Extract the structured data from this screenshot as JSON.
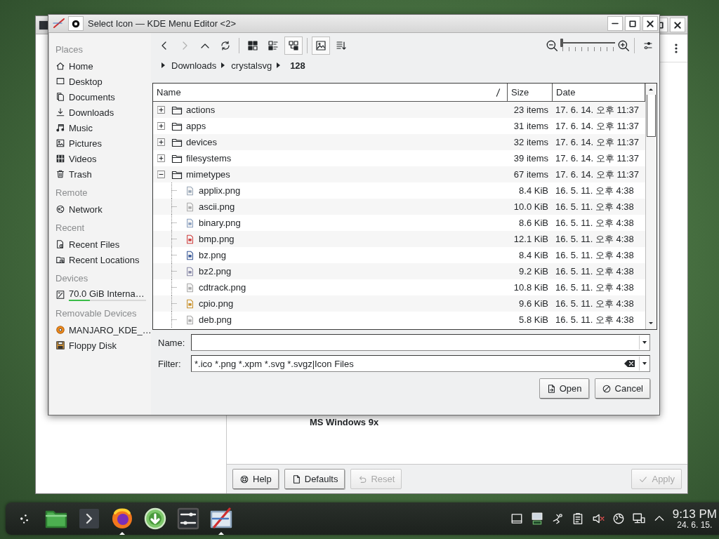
{
  "background_window": {
    "caption": "MS Windows 9x",
    "buttons": [
      {
        "label": "Help",
        "disabled": false
      },
      {
        "label": "Defaults",
        "disabled": false
      },
      {
        "label": "Reset",
        "disabled": true
      },
      {
        "label": "Apply",
        "disabled": true
      }
    ]
  },
  "dialog": {
    "title": "Select Icon — KDE Menu Editor <2>",
    "view_modes": [
      {
        "selected": false
      },
      {
        "selected": false
      },
      {
        "selected": true
      }
    ],
    "preview": {
      "on": true
    },
    "zoom": {
      "level": 0
    },
    "breadcrumb": [
      {
        "label": "Downloads",
        "current": false
      },
      {
        "label": "crystalsvg",
        "current": false
      },
      {
        "label": "128",
        "current": true
      }
    ],
    "places": [
      {
        "heading": "Places",
        "items": [
          {
            "label": "Home"
          },
          {
            "label": "Desktop"
          },
          {
            "label": "Documents"
          },
          {
            "label": "Downloads"
          },
          {
            "label": "Music"
          },
          {
            "label": "Pictures"
          },
          {
            "label": "Videos"
          },
          {
            "label": "Trash"
          }
        ]
      },
      {
        "heading": "Remote",
        "items": [
          {
            "label": "Network"
          }
        ]
      },
      {
        "heading": "Recent",
        "items": [
          {
            "label": "Recent Files"
          },
          {
            "label": "Recent Locations"
          }
        ]
      },
      {
        "heading": "Devices",
        "items": [
          {
            "label": "70.0 GiB Interna…",
            "level": 0.27
          }
        ]
      },
      {
        "heading": "Removable Devices",
        "items": [
          {
            "label": "MANJARO_KDE_…"
          },
          {
            "label": "Floppy Disk"
          }
        ]
      }
    ],
    "columns": [
      "Name",
      "Size",
      "Date"
    ],
    "rows": [
      {
        "name": "actions",
        "kind": "folder",
        "expanded": false,
        "size": "23 items",
        "date": "17. 6. 14. 오후 11:37"
      },
      {
        "name": "apps",
        "kind": "folder",
        "expanded": false,
        "size": "31 items",
        "date": "17. 6. 14. 오후 11:37"
      },
      {
        "name": "devices",
        "kind": "folder",
        "expanded": false,
        "size": "32 items",
        "date": "17. 6. 14. 오후 11:37"
      },
      {
        "name": "filesystems",
        "kind": "folder",
        "expanded": false,
        "size": "39 items",
        "date": "17. 6. 14. 오후 11:37"
      },
      {
        "name": "mimetypes",
        "kind": "folder",
        "expanded": true,
        "size": "67 items",
        "date": "17. 6. 14. 오후 11:37",
        "children": [
          {
            "name": "applix.png",
            "kind": "file",
            "size": "8.4 KiB",
            "date": "16. 5. 11. 오후 4:38"
          },
          {
            "name": "ascii.png",
            "kind": "file",
            "size": "10.0 KiB",
            "date": "16. 5. 11. 오후 4:38"
          },
          {
            "name": "binary.png",
            "kind": "file",
            "size": "8.6 KiB",
            "date": "16. 5. 11. 오후 4:38"
          },
          {
            "name": "bmp.png",
            "kind": "file",
            "size": "12.1 KiB",
            "date": "16. 5. 11. 오후 4:38"
          },
          {
            "name": "bz.png",
            "kind": "file",
            "size": "8.4 KiB",
            "date": "16. 5. 11. 오후 4:38"
          },
          {
            "name": "bz2.png",
            "kind": "file",
            "size": "9.2 KiB",
            "date": "16. 5. 11. 오후 4:38"
          },
          {
            "name": "cdtrack.png",
            "kind": "file",
            "size": "10.8 KiB",
            "date": "16. 5. 11. 오후 4:38"
          },
          {
            "name": "cpio.png",
            "kind": "file",
            "size": "9.6 KiB",
            "date": "16. 5. 11. 오후 4:38"
          },
          {
            "name": "deb.png",
            "kind": "file",
            "size": "5.8 KiB",
            "date": "16. 5. 11. 오후 4:38"
          }
        ]
      }
    ],
    "fields": [
      {
        "label": "Name:"
      },
      {
        "label": "Filter:",
        "value": "*.ico *.png *.xpm *.svg *.svgz|Icon Files"
      }
    ],
    "buttons": [
      {
        "label": "Open",
        "kind": "open"
      },
      {
        "label": "Cancel",
        "kind": "cancel"
      }
    ]
  },
  "taskbar": {
    "tasks": [
      {
        "active": false
      },
      {
        "active": false
      },
      {
        "active": false
      },
      {
        "active": true
      },
      {
        "active": false
      },
      {
        "active": false
      },
      {
        "active": true
      }
    ],
    "clock": {
      "time": "9:13 PM",
      "date": "24. 6. 15."
    }
  }
}
